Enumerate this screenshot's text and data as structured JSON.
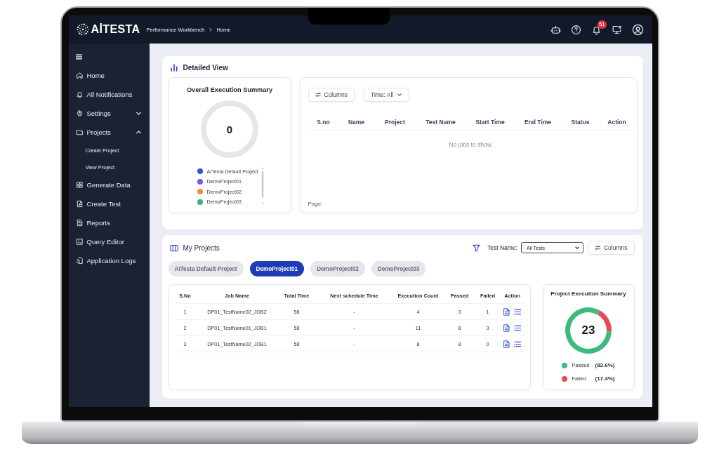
{
  "top_bar": {
    "logo": "AİTESTA",
    "breadcrumb": [
      "Performance Workbench",
      "Home"
    ],
    "notification_count": "51"
  },
  "sidebar": {
    "items": [
      {
        "label": "Home",
        "kind": "link"
      },
      {
        "label": "All Notifications",
        "kind": "link"
      },
      {
        "label": "Settings",
        "kind": "group",
        "expanded": false
      },
      {
        "label": "Projects",
        "kind": "group",
        "expanded": true,
        "children": [
          {
            "label": "Create Project"
          },
          {
            "label": "View Project"
          }
        ]
      },
      {
        "label": "Generate Data",
        "kind": "link"
      },
      {
        "label": "Create Test",
        "kind": "link"
      },
      {
        "label": "Reports",
        "kind": "link"
      },
      {
        "label": "Query Editor",
        "kind": "link"
      },
      {
        "label": "Application Logs",
        "kind": "link"
      }
    ]
  },
  "detailed_view": {
    "title": "Detailed View",
    "summary": {
      "title": "Overall Execution Summary",
      "total": "0",
      "legend": [
        {
          "label": "AITesta Default Project",
          "color": "#3551d8"
        },
        {
          "label": "DemoProject01",
          "color": "#7a5ae0"
        },
        {
          "label": "DemoProject02",
          "color": "#f58d2c"
        },
        {
          "label": "DemoProject03",
          "color": "#34b37b"
        }
      ]
    },
    "jobs": {
      "columns_button": "Columns",
      "time_filter": "Time: All",
      "columns": [
        "S.no",
        "Name",
        "Project",
        "Test Name",
        "Start Time",
        "End Time",
        "Status",
        "Action"
      ],
      "empty_message": "No jobs to show.",
      "pager_label": "Page:"
    }
  },
  "my_projects": {
    "title": "My Projects",
    "filter_label": "Test Name:",
    "filter_value": "All Tests",
    "columns_button": "Columns",
    "tabs": [
      {
        "label": "AITesta Default Project",
        "selected": false
      },
      {
        "label": "DemoProject01",
        "selected": true
      },
      {
        "label": "DemoProject02",
        "selected": false
      },
      {
        "label": "DemoProject03",
        "selected": false
      }
    ],
    "table": {
      "columns": [
        "S.No",
        "Job Name",
        "Total Time",
        "Next schedule Time",
        "Execution Count",
        "Passed",
        "Failed",
        "Action"
      ],
      "rows": [
        [
          "1",
          "DP01_TestName02_JOB2",
          "58",
          "-",
          "4",
          "3",
          "1"
        ],
        [
          "2",
          "DP01_TestName01_JOB1",
          "58",
          "-",
          "11",
          "8",
          "3"
        ],
        [
          "3",
          "DP01_TestName02_JOB1",
          "58",
          "-",
          "8",
          "8",
          "0"
        ]
      ]
    },
    "summary": {
      "title": "Project Execution Summary",
      "total": "23",
      "chart_data": {
        "type": "donut",
        "categories": [
          "Passed",
          "Failed"
        ],
        "values": [
          82.6,
          17.4
        ]
      },
      "legend": [
        {
          "value": "(82.6%)",
          "color": "#3dbb7e"
        },
        {
          "value": "(17.4%)",
          "color": "#e64a55"
        }
      ]
    }
  }
}
